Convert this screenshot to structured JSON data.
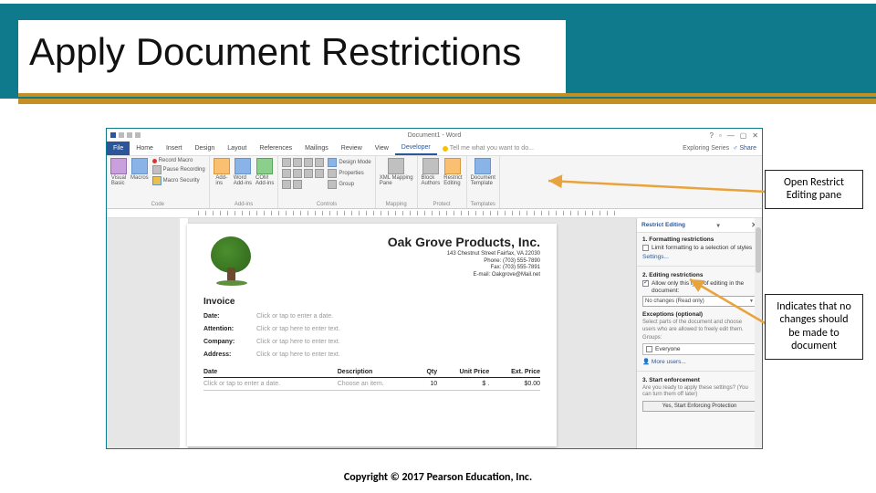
{
  "slide": {
    "title": "Apply Document Restrictions",
    "copyright": "Copyright © 2017 Pearson Education, Inc."
  },
  "callouts": {
    "top": "Open Restrict Editing pane",
    "bottom": "Indicates that no changes should be made to document"
  },
  "word": {
    "titlebar": {
      "doc_title": "Document1 - Word"
    },
    "tabs": {
      "file": "File",
      "items": [
        "Home",
        "Insert",
        "Design",
        "Layout",
        "References",
        "Mailings",
        "Review",
        "View",
        "Developer"
      ],
      "active_index": 8,
      "tell_me": "Tell me what you want to do...",
      "user": "Exploring Series",
      "share": "Share"
    },
    "ribbon": {
      "groups": {
        "code": {
          "label": "Code",
          "visual_basic": "Visual\nBasic",
          "macros": "Macros",
          "record_macro": "Record Macro",
          "pause_recording": "Pause Recording",
          "macro_security": "Macro Security"
        },
        "addins": {
          "label": "Add-ins",
          "addins": "Add-\nins",
          "word_addins": "Word\nAdd-ins",
          "com_addins": "COM\nAdd-ins"
        },
        "controls": {
          "label": "Controls",
          "design_mode": "Design Mode",
          "properties": "Properties",
          "group": "Group"
        },
        "mapping": {
          "label": "Mapping",
          "xml_mapping": "XML Mapping\nPane"
        },
        "protect": {
          "label": "Protect",
          "block_authors": "Block\nAuthors",
          "restrict_editing": "Restrict\nEditing"
        },
        "templates": {
          "label": "Templates",
          "document_template": "Document\nTemplate"
        }
      }
    },
    "restrict_pane": {
      "title": "Restrict Editing",
      "sec1": {
        "num": "1.",
        "heading": "Formatting restrictions",
        "check": "Limit formatting to a selection of styles",
        "settings_link": "Settings..."
      },
      "sec2": {
        "num": "2.",
        "heading": "Editing restrictions",
        "check": "Allow only this type of editing in the document:",
        "select_value": "No changes (Read only)",
        "exceptions_h": "Exceptions (optional)",
        "exceptions_text": "Select parts of the document and choose users who are allowed to freely edit them.",
        "groups_label": "Groups:",
        "everyone": "Everyone",
        "more_users": "More users..."
      },
      "sec3": {
        "num": "3.",
        "heading": "Start enforcement",
        "text": "Are you ready to apply these settings? (You can turn them off later)",
        "button": "Yes, Start Enforcing Protection"
      }
    },
    "document": {
      "company": "Oak Grove Products, Inc.",
      "addr1": "143 Chestnut Street  Fairfax, VA 22030",
      "addr2": "Phone: (703) 555-7890",
      "addr3": "Fax: (703) 555-7891",
      "addr4": "E-mail: Oakgrove@Mail.net",
      "invoice_h": "Invoice",
      "fields": {
        "date_label": "Date:",
        "date_val": "Click or tap to enter a date.",
        "attn_label": "Attention:",
        "attn_val": "Click or tap here to enter text.",
        "company_label": "Company:",
        "company_val": "Click or tap here to enter text.",
        "address_label": "Address:",
        "address_val": "Click or tap here to enter text."
      },
      "table": {
        "headers": [
          "Date",
          "Description",
          "Qty",
          "Unit Price",
          "Ext. Price"
        ],
        "row": {
          "date": "Click or tap to enter a date.",
          "desc": "Choose an item.",
          "qty": "10",
          "unit": "$       .",
          "ext": "$0.00"
        }
      }
    }
  }
}
